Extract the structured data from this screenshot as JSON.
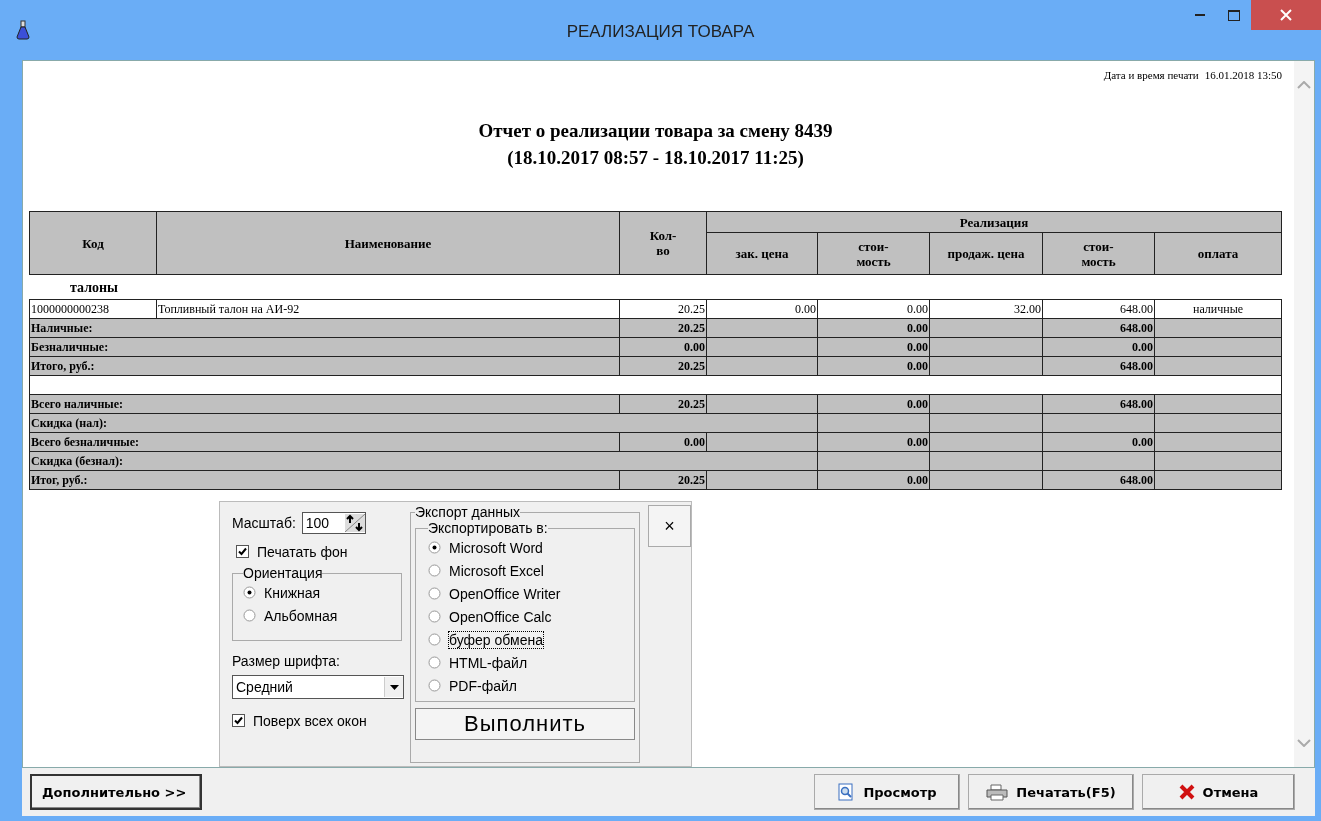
{
  "window": {
    "title": "РЕАЛИЗАЦИЯ ТОВАРА"
  },
  "report": {
    "print_label": "Дата и время печати",
    "print_datetime": "16.01.2018 13:50",
    "title": "Отчет о реализации товара за смену 8439",
    "period": "(18.10.2017 08:57 - 18.10.2017 11:25)"
  },
  "table": {
    "columns": [
      "Код",
      "Наименование",
      "Кол-во"
    ],
    "group_header": "Реализация",
    "sub_columns": [
      "зак. цена",
      "стои-мость",
      "продаж. цена",
      "стои-мость",
      "оплата"
    ],
    "rows": [
      {
        "kind": "group",
        "label": "талоны"
      },
      {
        "kind": "item",
        "cells": [
          "1000000000238",
          "Топливный талон на АИ-92",
          "20.25",
          "0.00",
          "0.00",
          "32.00",
          "648.00",
          "наличные"
        ]
      },
      {
        "kind": "total",
        "label": "Наличные:",
        "qty": "20.25",
        "cost": "0.00",
        "sale_cost": "648.00"
      },
      {
        "kind": "total",
        "label": "Безналичные:",
        "qty": "0.00",
        "cost": "0.00",
        "sale_cost": "0.00"
      },
      {
        "kind": "total",
        "label": "Итого, руб.:",
        "qty": "20.25",
        "cost": "0.00",
        "sale_cost": "648.00"
      },
      {
        "kind": "blank"
      },
      {
        "kind": "total",
        "label": "Всего наличные:",
        "qty": "20.25",
        "cost": "0.00",
        "sale_cost": "648.00"
      },
      {
        "kind": "discount",
        "label": "Скидка (нал):"
      },
      {
        "kind": "total",
        "label": "Всего безналичные:",
        "qty": "0.00",
        "cost": "0.00",
        "sale_cost": "0.00"
      },
      {
        "kind": "discount",
        "label": "Скидка (безнал):"
      },
      {
        "kind": "total",
        "label": "Итог, руб.:",
        "qty": "20.25",
        "cost": "0.00",
        "sale_cost": "648.00"
      }
    ]
  },
  "print_options": {
    "scale": {
      "label": "Масштаб:",
      "value": "100"
    },
    "print_background": {
      "label": "Печатать фон",
      "checked": true
    },
    "orientation": {
      "legend": "Ориентация",
      "options": [
        {
          "label": "Книжная",
          "selected": true
        },
        {
          "label": "Альбомная",
          "selected": false
        }
      ]
    },
    "font_size": {
      "label": "Размер шрифта:",
      "value": "Средний"
    },
    "always_on_top": {
      "label": "Поверх всех окон",
      "checked": true
    },
    "export": {
      "legend": "Экспорт данных",
      "target_legend": "Экспортировать в:",
      "targets": [
        {
          "label": "Microsoft Word",
          "selected": true,
          "focused": false
        },
        {
          "label": "Microsoft Excel",
          "selected": false,
          "focused": false
        },
        {
          "label": "OpenOffice Writer",
          "selected": false,
          "focused": false
        },
        {
          "label": "OpenOffice Calc",
          "selected": false,
          "focused": false
        },
        {
          "label": "буфер обмена",
          "selected": false,
          "focused": true
        },
        {
          "label": "HTML-файл",
          "selected": false,
          "focused": false
        },
        {
          "label": "PDF-файл",
          "selected": false,
          "focused": false
        }
      ],
      "run_button": "Выполнить"
    },
    "close_button": "×"
  },
  "actions": {
    "more_button": "Дополнительно >>",
    "preview_button": "Просмотр",
    "print_button": "Печатать(F5)",
    "cancel_button": "Отмена"
  }
}
